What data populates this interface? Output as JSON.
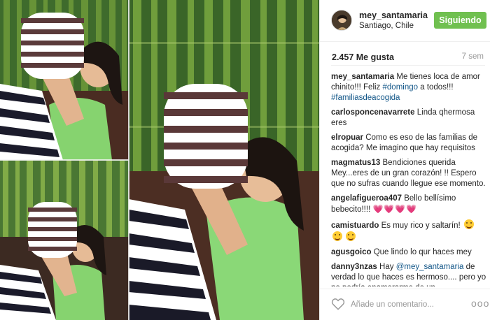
{
  "post": {
    "photo_alt": "Woman kissing baby in striped outfit",
    "user": {
      "username": "mey_santamaria",
      "location": "Santiago, Chile"
    },
    "follow_button_label": "Siguiendo",
    "likes": "2.457 Me gusta",
    "age": "7 sem",
    "caption": {
      "username": "mey_santamaria",
      "text": "Me tienes loca de amor chinito!!! Feliz",
      "tag1": "#domingo",
      "text2": "a todos!!!",
      "tag2": "#familiasdeacogida"
    },
    "comments": [
      {
        "username": "carlosponcenavarrete",
        "text": "Linda qhermosa eres"
      },
      {
        "username": "elropuar",
        "text": "Como es eso de las familias de acogida? Me imagino que hay requisitos"
      },
      {
        "username": "magmatus13",
        "text": "Bendiciones querida Mey...eres de un gran corazón! !! Espero que no sufras cuando llegue ese momento."
      },
      {
        "username": "angelafigueroa407",
        "text": "Bello bellísimo bebecito!!!!",
        "hearts": "💗💗💗💗"
      },
      {
        "username": "camistuardo",
        "text": "Es muy rico y saltarín!"
      },
      {
        "username": "agusgoico",
        "text": "Que lindo lo qur haces mey"
      },
      {
        "username": "danny3nzas",
        "text": "Hay",
        "mention": "@mey_santamaria",
        "text2": "de verdad lo que haces es hermoso.... pero yo no podría enamorarme de un"
      }
    ],
    "comment_placeholder": "Añade un comentario...",
    "more_label": "ooo"
  },
  "icons": {
    "like": "heart-outline-icon",
    "more": "more-dots-icon"
  },
  "colors": {
    "follow_green": "#70c050",
    "link_blue": "#125688",
    "muted_gray": "#999999"
  }
}
